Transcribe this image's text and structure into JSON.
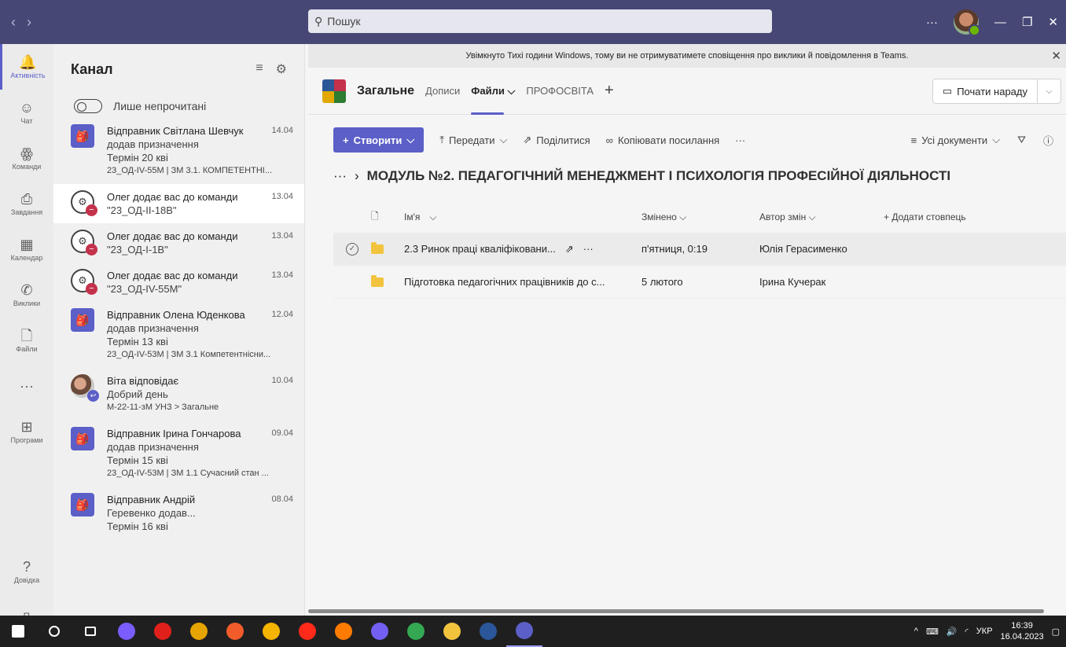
{
  "search": {
    "placeholder": "Пошук"
  },
  "titlebar": {
    "more": "···"
  },
  "rail": [
    {
      "key": "activity",
      "label": "Активність",
      "icon": "bell-icon",
      "glyph": "🔔",
      "active": true
    },
    {
      "key": "chat",
      "label": "Чат",
      "icon": "chat-icon",
      "glyph": "☺"
    },
    {
      "key": "teams",
      "label": "Команди",
      "icon": "teams-icon",
      "glyph": "ꙮ"
    },
    {
      "key": "tasks",
      "label": "Завдання",
      "icon": "tasks-icon",
      "glyph": "⎙"
    },
    {
      "key": "calendar",
      "label": "Календар",
      "icon": "calendar-icon",
      "glyph": "▦"
    },
    {
      "key": "calls",
      "label": "Виклики",
      "icon": "phone-icon",
      "glyph": "✆"
    },
    {
      "key": "files",
      "label": "Файли",
      "icon": "file-icon",
      "glyph": "🗋"
    },
    {
      "key": "more",
      "label": "",
      "icon": "more-icon",
      "glyph": "···"
    },
    {
      "key": "apps",
      "label": "Програми",
      "icon": "apps-icon",
      "glyph": "⊞"
    },
    {
      "key": "help",
      "label": "Довідка",
      "icon": "help-icon",
      "glyph": "?"
    },
    {
      "key": "mobile",
      "label": "",
      "icon": "mobile-icon",
      "glyph": "▯"
    }
  ],
  "feed": {
    "title": "Канал",
    "unread_label": "Лише непрочитані",
    "items": [
      {
        "kind": "assign",
        "title": "Відправник Світлана Шевчук",
        "date": "14.04",
        "sub": "додав призначення",
        "line3": "Термін 20 кві",
        "meta": "23_ОД-IV-55М | ЗМ 3.1. КОМПЕТЕНТНІ..."
      },
      {
        "kind": "team",
        "title": "Олег додає вас до команди",
        "date": "13.04",
        "sub": "\"23_ОД-ІІ-18В\"",
        "line3": "",
        "meta": "",
        "selected": true
      },
      {
        "kind": "team",
        "title": "Олег додає вас до команди",
        "date": "13.04",
        "sub": "\"23_ОД-І-1В\"",
        "line3": "",
        "meta": ""
      },
      {
        "kind": "team",
        "title": "Олег додає вас до команди",
        "date": "13.04",
        "sub": "\"23_ОД-IV-55М\"",
        "line3": "",
        "meta": ""
      },
      {
        "kind": "assign",
        "title": "Відправник Олена Юденкова",
        "date": "12.04",
        "sub": "додав призначення",
        "line3": "Термін 13 кві",
        "meta": "23_ОД-IV-53М | ЗМ 3.1 Компетентнісни..."
      },
      {
        "kind": "person",
        "title": "Віта відповідає",
        "date": "10.04",
        "sub": "Добрий день",
        "line3": "",
        "meta": "М-22-11-зМ УНЗ > Загальне"
      },
      {
        "kind": "assign",
        "title": "Відправник Ірина Гончарова",
        "date": "09.04",
        "sub": "додав призначення",
        "line3": "Термін 15 кві",
        "meta": "23_ОД-IV-53М | ЗМ 1.1 Сучасний стан ..."
      },
      {
        "kind": "assign",
        "title": "Відправник Андрій",
        "date": "08.04",
        "sub": "Геревенко додав...",
        "line3": "Термін 16 кві",
        "meta": ""
      }
    ]
  },
  "banner": {
    "text": "Увімкнуто Тихі години Windows, тому ви не отримуватимете сповіщення про виклики й повідомлення в Teams."
  },
  "channel": {
    "title": "Загальне",
    "tabs": [
      {
        "label": "Дописи",
        "active": false
      },
      {
        "label": "Файли ⌵",
        "active": true
      },
      {
        "label": "ПРОФОСВІТА",
        "active": false
      }
    ],
    "meet_label": "Почати нараду"
  },
  "commands": {
    "create": "Створити",
    "upload": "Передати",
    "share": "Поділитися",
    "copy_link": "Копіювати посилання",
    "more": "···",
    "view": "Усі документи"
  },
  "breadcrumb": {
    "ellipsis": "···",
    "path": "МОДУЛЬ №2. ПЕДАГОГІЧНИЙ МЕНЕДЖМЕНТ І ПСИХОЛОГІЯ ПРОФЕСІЙНОЇ ДІЯЛЬНОСТІ"
  },
  "files": {
    "columns": {
      "name": "Ім'я",
      "modified": "Змінено",
      "author": "Автор змін",
      "add": "Додати стовпець"
    },
    "rows": [
      {
        "name": "2.3 Ринок праці кваліфіковани...",
        "modified": "п'ятниця, 0:19",
        "author": "Юлія Герасименко",
        "hover": true
      },
      {
        "name": "Підготовка педагогічних працівників до с...",
        "modified": "5 лютого",
        "author": "Ірина Кучерак",
        "hover": false
      }
    ]
  },
  "taskbar": {
    "lang": "УКР",
    "time": "16:39",
    "date": "16.04.2023",
    "apps": [
      {
        "name": "windows-start-icon",
        "color": "#ffffff"
      },
      {
        "name": "search-icon",
        "color": "#1f1f1f"
      },
      {
        "name": "task-view-icon",
        "color": "#1f1f1f"
      },
      {
        "name": "app-purple-icon",
        "color": "#7b5cff"
      },
      {
        "name": "opera-icon",
        "color": "#e0201b"
      },
      {
        "name": "eye-app-icon",
        "color": "#e6a400"
      },
      {
        "name": "color-app-icon",
        "color": "#f25c2b"
      },
      {
        "name": "chrome-icon",
        "color": "#f4b400"
      },
      {
        "name": "yandex-icon",
        "color": "#ff2a1a"
      },
      {
        "name": "firefox-icon",
        "color": "#ff7b00"
      },
      {
        "name": "viber-icon",
        "color": "#7360f2"
      },
      {
        "name": "chrome-2-icon",
        "color": "#34a853"
      },
      {
        "name": "file-explorer-icon",
        "color": "#f2c43e"
      },
      {
        "name": "word-icon",
        "color": "#2b579a"
      },
      {
        "name": "teams-taskbar-icon",
        "color": "#5b5fc7"
      }
    ]
  }
}
